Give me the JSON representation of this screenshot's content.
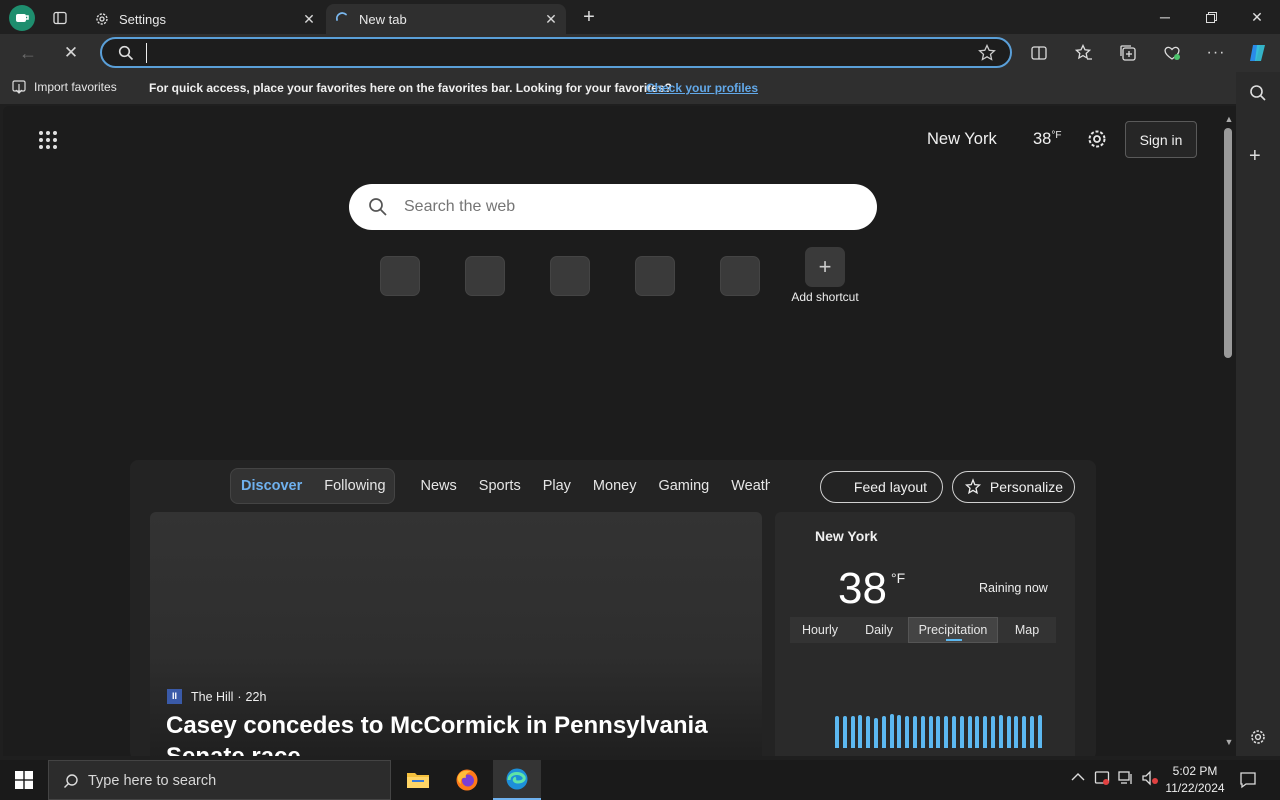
{
  "tabs": [
    {
      "label": "Settings"
    },
    {
      "label": "New tab"
    }
  ],
  "toolbar": {
    "address_value": ""
  },
  "favorites_bar": {
    "import_label": "Import favorites",
    "message": "For quick access, place your favorites here on the favorites bar. Looking for your favorites?",
    "link": "Check your profiles"
  },
  "newtab": {
    "location": "New York",
    "temp": "38",
    "temp_unit": "°F",
    "sign_in": "Sign in",
    "search_placeholder": "Search the web",
    "add_shortcut": "Add shortcut",
    "nav": [
      "Discover",
      "Following",
      "News",
      "Sports",
      "Play",
      "Money",
      "Gaming",
      "Weathe"
    ],
    "feed_layout": "Feed layout",
    "personalize": "Personalize"
  },
  "news_card": {
    "source": "The Hill",
    "age": "22h",
    "headline_line1": "Casey concedes to McCormick in Pennsylvania",
    "headline_line2": "Senate race"
  },
  "weather_card": {
    "city": "New York",
    "temp": "38",
    "unit": "°F",
    "condition": "Raining now",
    "tabs": [
      "Hourly",
      "Daily",
      "Precipitation",
      "Map"
    ],
    "active_tab": "Precipitation",
    "precip_levels": [
      0.88,
      0.9,
      0.88,
      0.93,
      0.88,
      0.82,
      0.9,
      0.95,
      0.92,
      0.9,
      0.9,
      0.9,
      0.88,
      0.9,
      0.9,
      0.9,
      0.9,
      0.9,
      0.88,
      0.88,
      0.9,
      0.92,
      0.9,
      0.9,
      0.9,
      0.88,
      0.92
    ]
  },
  "taskbar": {
    "search_placeholder": "Type here to search",
    "time": "5:02 PM",
    "date": "11/22/2024"
  },
  "colors": {
    "accent": "#5a9fd8",
    "link": "#62a8e8",
    "precip_bar": "#5cb8f0"
  }
}
